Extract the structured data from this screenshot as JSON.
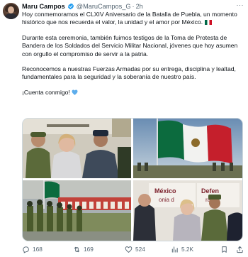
{
  "author": {
    "name": "Maru Campos",
    "handle": "@MaruCampos_G",
    "separator": "·",
    "time": "2h",
    "more_label": "···"
  },
  "tweet": {
    "paragraphs": [
      "Hoy conmemoramos el CLXIV Aniversario de la Batalla de Puebla, un momento histórico que nos recuerda el valor, la unidad y el amor por México.",
      "Durante esta ceremonia, también fuimos testigos de la Toma de Protesta de Bandera de los Soldados del Servicio Militar Nacional, jóvenes que hoy asumen con orgullo el compromiso de servir a la patria.",
      "Reconocemos a nuestras Fuerzas Armadas por su entrega, disciplina y lealtad, fundamentales para la seguridad y la soberanía de nuestro país.",
      "¡Cuenta conmigo!"
    ],
    "emoji_flag": "mexico-flag",
    "emoji_heart": "blue-heart"
  },
  "media": {
    "signage_p4": "México",
    "signage_p4b": "Defen",
    "signage_p4c": "onia d",
    "signage_p4d": "ra de"
  },
  "actions": {
    "replies": "168",
    "reposts": "169",
    "likes": "524",
    "views": "5.2K"
  },
  "colors": {
    "accent": "#1d9bf0",
    "text": "#0f1419",
    "muted": "#536471",
    "border": "#cfd9de"
  }
}
